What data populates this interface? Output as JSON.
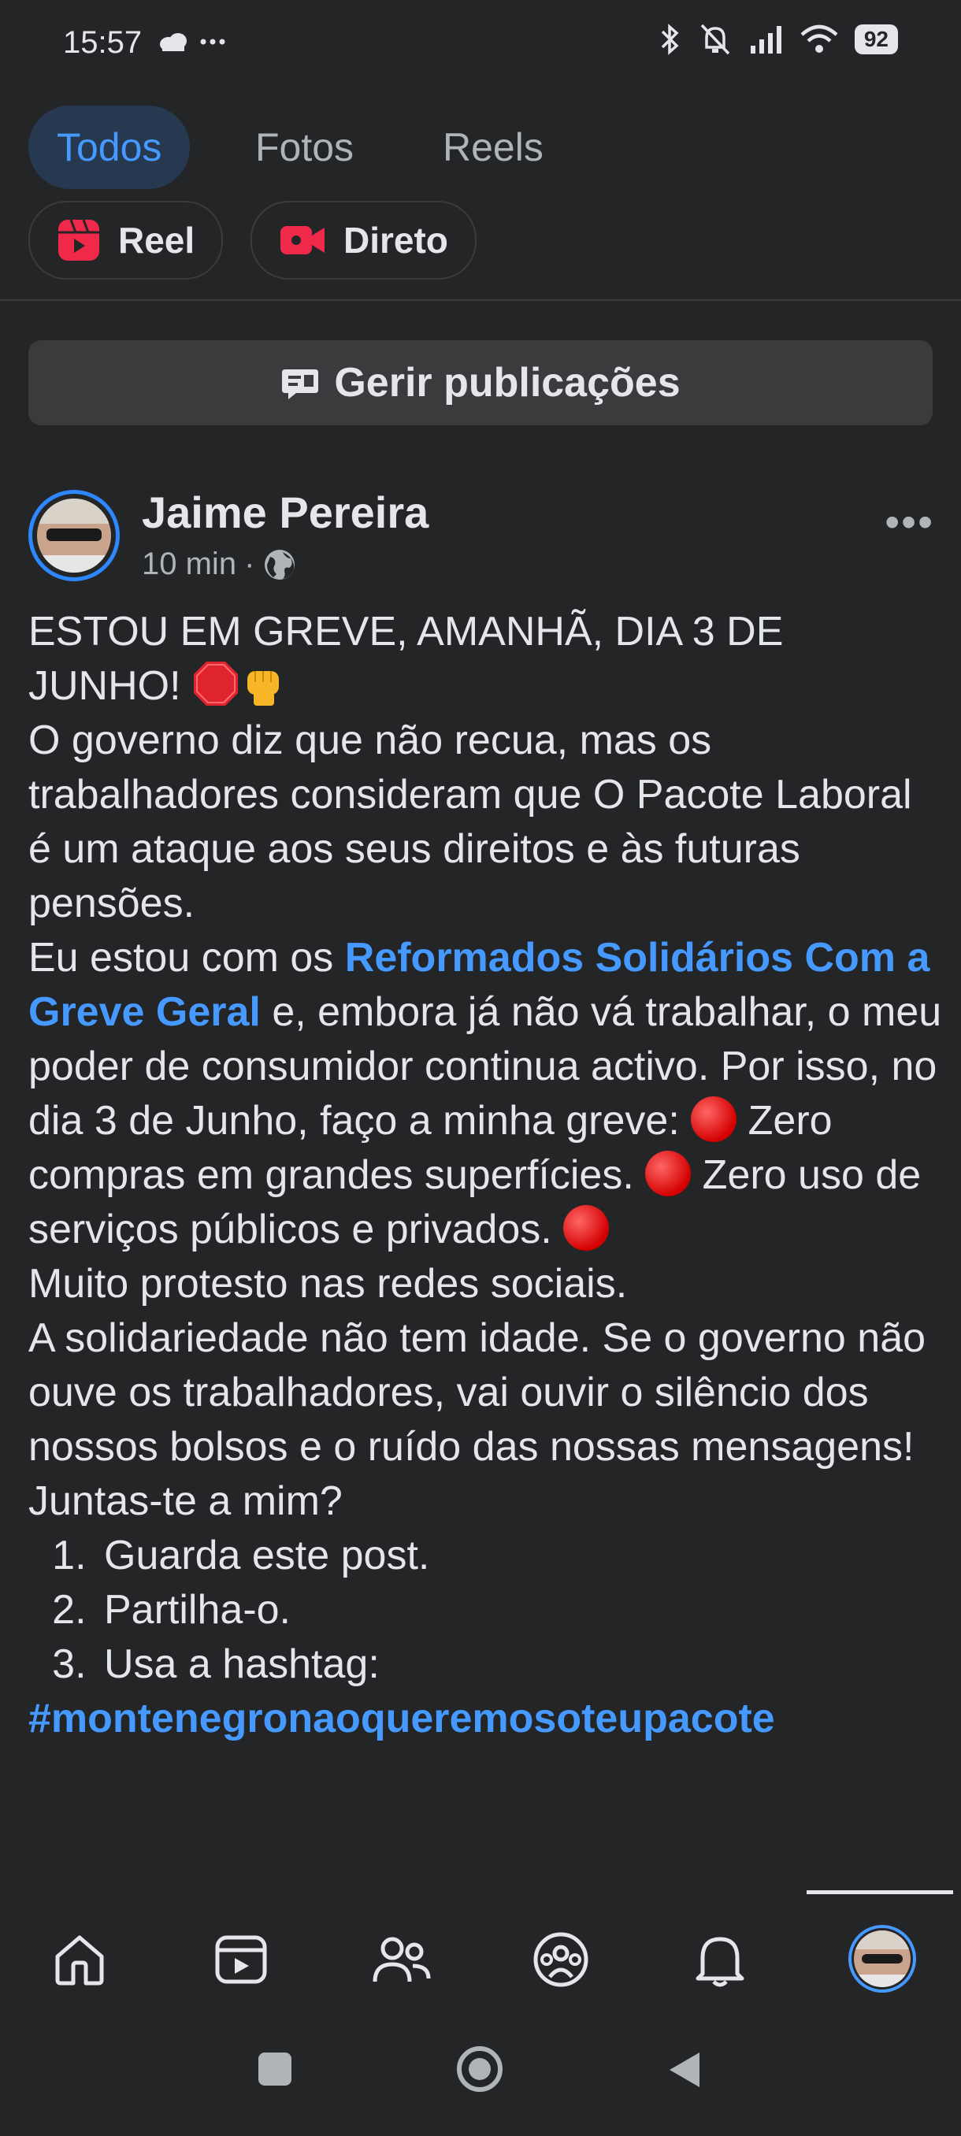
{
  "status_bar": {
    "time": "15:57",
    "left_icons": [
      "cloud-icon",
      "more-dots-icon"
    ],
    "right_icons": [
      "bluetooth-icon",
      "mute-icon",
      "signal-icon",
      "wifi-icon"
    ],
    "battery": "92"
  },
  "filter_tabs": [
    {
      "label": "Todos",
      "active": true
    },
    {
      "label": "Fotos",
      "active": false
    },
    {
      "label": "Reels",
      "active": false
    }
  ],
  "create_chips": [
    {
      "label": "Reel",
      "icon": "reel-icon"
    },
    {
      "label": "Direto",
      "icon": "live-video-icon"
    }
  ],
  "manage_posts": {
    "label": "Gerir publicações",
    "icon": "manage-posts-icon"
  },
  "post": {
    "author": "Jaime Pereira",
    "time": "10 min",
    "separator": "·",
    "audience_icon": "globe-icon",
    "more": "•••",
    "body": {
      "line1": "ESTOU EM GREVE, AMANHÃ, DIA 3 DE JUNHO! ",
      "para2": "O governo diz que não recua, mas os trabalhadores consideram que O Pacote Laboral é um ataque aos seus direitos e às futuras pensões.",
      "para3_a": "Eu estou com os  ",
      "para3_link": "Reformados Solidários Com a Greve Geral",
      "para3_b": " e, embora já não vá trabalhar, o meu poder de consumidor continua activo. Por isso, no dia 3 de Junho, faço a minha greve: ",
      "para3_c": " Zero compras em grandes superfícies. ",
      "para3_d": " Zero uso  de serviços públicos e privados. ",
      "para3_e": " Muito protesto nas redes sociais.",
      "para4": "A solidariedade não tem idade. Se o governo não ouve os trabalhadores, vai ouvir o silêncio dos nossos bolsos e o ruído das nossas mensagens!",
      "para5": "Juntas-te a mim?",
      "list": [
        "Guarda este post.",
        "Partilha-o.",
        "Usa a hashtag:"
      ],
      "hashtag": "#montenegronaoqueremosoteupacote"
    }
  },
  "bottom_nav": [
    {
      "name": "home-icon",
      "active": false
    },
    {
      "name": "video-icon",
      "active": false
    },
    {
      "name": "friends-icon",
      "active": false
    },
    {
      "name": "groups-icon",
      "active": false
    },
    {
      "name": "notifications-icon",
      "active": false
    },
    {
      "name": "profile-avatar",
      "active": true
    }
  ],
  "system_nav": [
    "recents-button",
    "home-button",
    "back-button"
  ],
  "colors": {
    "background": "#242526",
    "accent": "#4599ff",
    "text": "#e4e6eb",
    "muted": "#b0b3b8"
  }
}
